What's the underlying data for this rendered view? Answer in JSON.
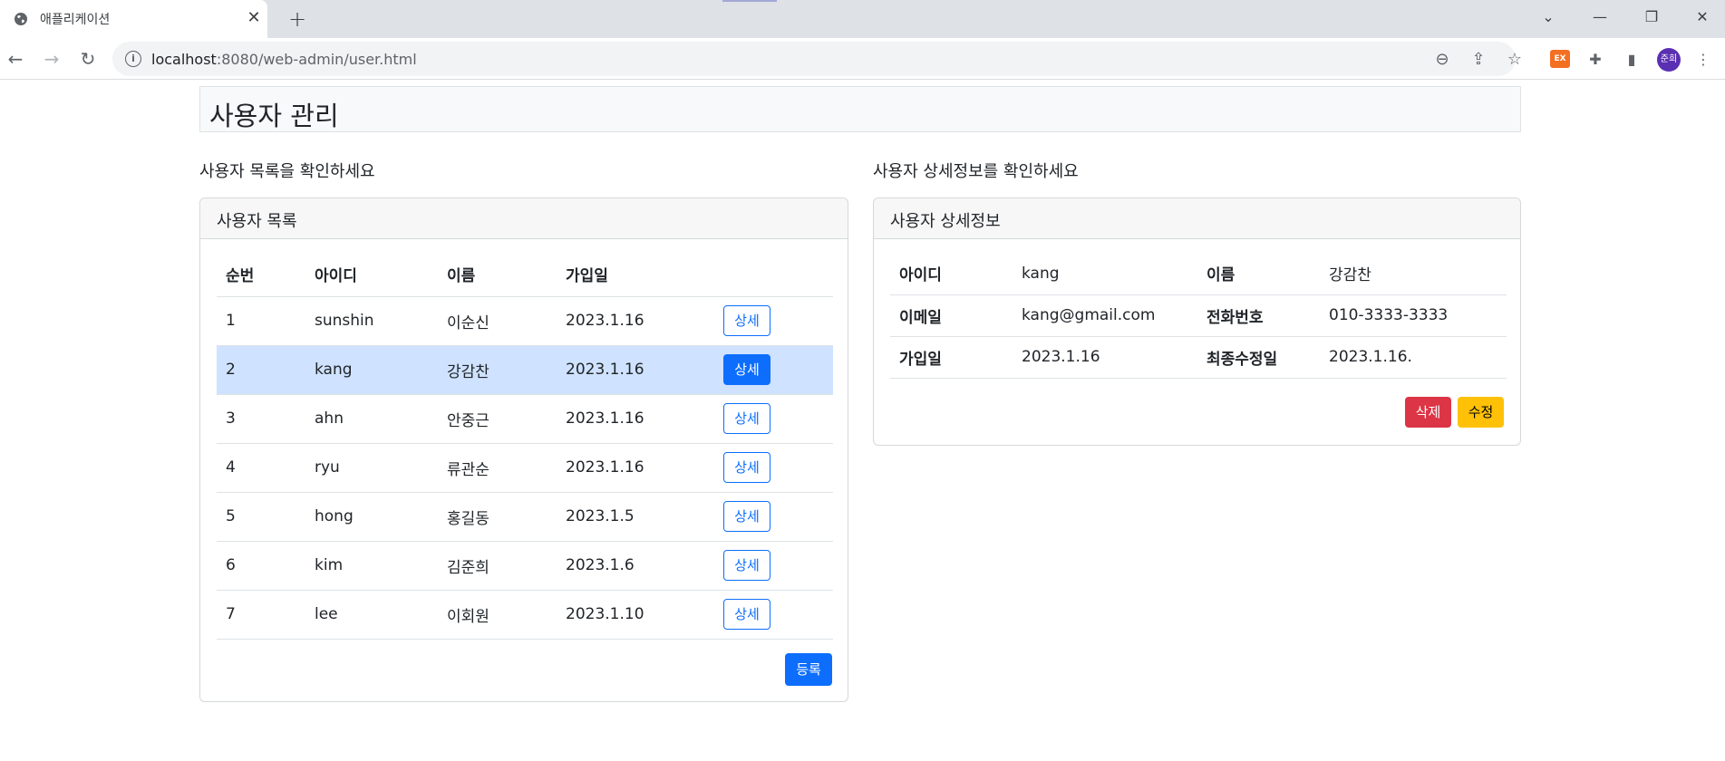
{
  "browser": {
    "tab_title": "애플리케이션",
    "url_host": "localhost",
    "url_rest": ":8080/web-admin/user.html",
    "profile_initials": "준희",
    "extension_badge": "EX",
    "icons": [
      "globe-icon",
      "close-icon",
      "plus-icon",
      "chevron-down-icon",
      "minimize-icon",
      "restore-icon",
      "window-close-icon",
      "back-icon",
      "forward-icon",
      "reload-icon",
      "info-icon",
      "zoom-out-icon",
      "share-icon",
      "star-icon",
      "puzzle-icon",
      "sidepanel-icon",
      "kebab-icon"
    ]
  },
  "page": {
    "title": "사용자 관리",
    "left_label": "사용자 목록을 확인하세요",
    "right_label": "사용자 상세정보를 확인하세요"
  },
  "list_card": {
    "header": "사용자 목록",
    "columns": [
      "순번",
      "아이디",
      "이름",
      "가입일"
    ],
    "rows": [
      {
        "no": "1",
        "id": "sunshin",
        "name": "이순신",
        "joined": "2023.1.16",
        "action": "상세"
      },
      {
        "no": "2",
        "id": "kang",
        "name": "강감찬",
        "joined": "2023.1.16",
        "action": "상세"
      },
      {
        "no": "3",
        "id": "ahn",
        "name": "안중근",
        "joined": "2023.1.16",
        "action": "상세"
      },
      {
        "no": "4",
        "id": "ryu",
        "name": "류관순",
        "joined": "2023.1.16",
        "action": "상세"
      },
      {
        "no": "5",
        "id": "hong",
        "name": "홍길동",
        "joined": "2023.1.5",
        "action": "상세"
      },
      {
        "no": "6",
        "id": "kim",
        "name": "김준희",
        "joined": "2023.1.6",
        "action": "상세"
      },
      {
        "no": "7",
        "id": "lee",
        "name": "이회원",
        "joined": "2023.1.10",
        "action": "상세"
      }
    ],
    "selected_row": 1,
    "register_label": "등록"
  },
  "detail_card": {
    "header": "사용자 상세정보",
    "rows": [
      {
        "k1": "아이디",
        "v1": "kang",
        "k2": "이름",
        "v2": "강감찬"
      },
      {
        "k1": "이메일",
        "v1": "kang@gmail.com",
        "k2": "전화번호",
        "v2": "010-3333-3333"
      },
      {
        "k1": "가입일",
        "v1": "2023.1.16",
        "k2": "최종수정일",
        "v2": "2023.1.16."
      }
    ],
    "delete_label": "삭제",
    "edit_label": "수정"
  },
  "colors": {
    "primary": "#0d6efd",
    "danger": "#dc3545",
    "warning": "#ffc107",
    "selected_row": "#cfe2ff"
  }
}
